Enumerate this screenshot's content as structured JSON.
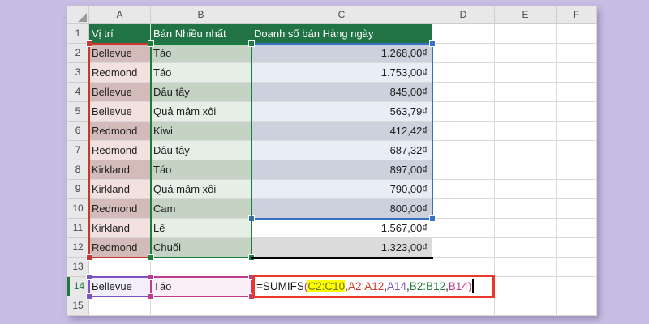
{
  "window": {
    "background": "#c7bee3"
  },
  "sheet": {
    "column_headers": [
      "A",
      "B",
      "C",
      "D",
      "E",
      "F"
    ],
    "row_headers": [
      "1",
      "2",
      "3",
      "4",
      "5",
      "6",
      "7",
      "8",
      "9",
      "10",
      "11",
      "12",
      "13",
      "14",
      "15"
    ],
    "active_row_header": "14",
    "header_row": {
      "location": "Vị trí",
      "product": "Bán Nhiều nhất",
      "sales": "Doanh số bán Hàng ngày"
    },
    "rows": [
      {
        "n": 2,
        "location": "Bellevue",
        "product": "Táo",
        "sales": "1.268,00₫"
      },
      {
        "n": 3,
        "location": "Redmond",
        "product": "Táo",
        "sales": "1.753,00₫"
      },
      {
        "n": 4,
        "location": "Bellevue",
        "product": "Dâu tây",
        "sales": "845,00₫"
      },
      {
        "n": 5,
        "location": "Bellevue",
        "product": "Quả mâm xôi",
        "sales": "563,79₫"
      },
      {
        "n": 6,
        "location": "Redmond",
        "product": "Kiwi",
        "sales": "412,42₫"
      },
      {
        "n": 7,
        "location": "Redmond",
        "product": "Dâu tây",
        "sales": "687,32₫"
      },
      {
        "n": 8,
        "location": "Kirkland",
        "product": "Táo",
        "sales": "897,00₫"
      },
      {
        "n": 9,
        "location": "Kirkland",
        "product": "Quả mâm xôi",
        "sales": "790,00₫"
      },
      {
        "n": 10,
        "location": "Redmond",
        "product": "Cam",
        "sales": "800,00₫"
      },
      {
        "n": 11,
        "location": "Kirkland",
        "product": "Lê",
        "sales": "1.567,00₫"
      },
      {
        "n": 12,
        "location": "Redmond",
        "product": "Chuối",
        "sales": "1.323,00₫"
      }
    ],
    "criteria_row": {
      "n": 14,
      "location": "Bellevue",
      "product": "Táo"
    },
    "formula": {
      "cell": "C14",
      "full_text": "=SUMIFS(C2:C10,A2:A12,A14,B2:B12,B14)",
      "tokens": [
        {
          "text": "=SUMIFS",
          "color": "#1a1a1a"
        },
        {
          "text": "(",
          "color": "#c7387f"
        },
        {
          "text": "C2:C10",
          "color": "#6f7400",
          "background": "#ffff00"
        },
        {
          "text": ",",
          "color": "#1a1a1a"
        },
        {
          "text": "A2:A12",
          "color": "#d0392b"
        },
        {
          "text": ",",
          "color": "#1a1a1a"
        },
        {
          "text": "A14",
          "color": "#7d53c9"
        },
        {
          "text": ",",
          "color": "#1a1a1a"
        },
        {
          "text": "B2:B12",
          "color": "#1d7c3c"
        },
        {
          "text": ",",
          "color": "#1a1a1a"
        },
        {
          "text": "B14",
          "color": "#c23b89"
        },
        {
          "text": ")",
          "color": "#c23b89"
        }
      ]
    },
    "colors": {
      "header_fill": "#217346",
      "header_text": "#ffffff",
      "location_even": "#d3bbb9",
      "location_odd": "#f3e1e0",
      "product_even": "#c5d3c5",
      "product_odd": "#e6efe5",
      "sales_sel_even": "#cbd2de",
      "sales_sel_odd": "#e9edf5",
      "sales_row11": "#ffffff",
      "sales_row12": "#dbdbdb",
      "criteria_location_fill": "#f2eefa",
      "criteria_product_fill": "#fbeff7",
      "range_red": "#c8372d",
      "range_green": "#1b7d3a",
      "range_blue": "#3a70c0",
      "range_purple": "#7b53c5",
      "range_magenta": "#bd3d8d",
      "formula_box_red": "#e8392b",
      "total_border_black": "#000000"
    }
  }
}
